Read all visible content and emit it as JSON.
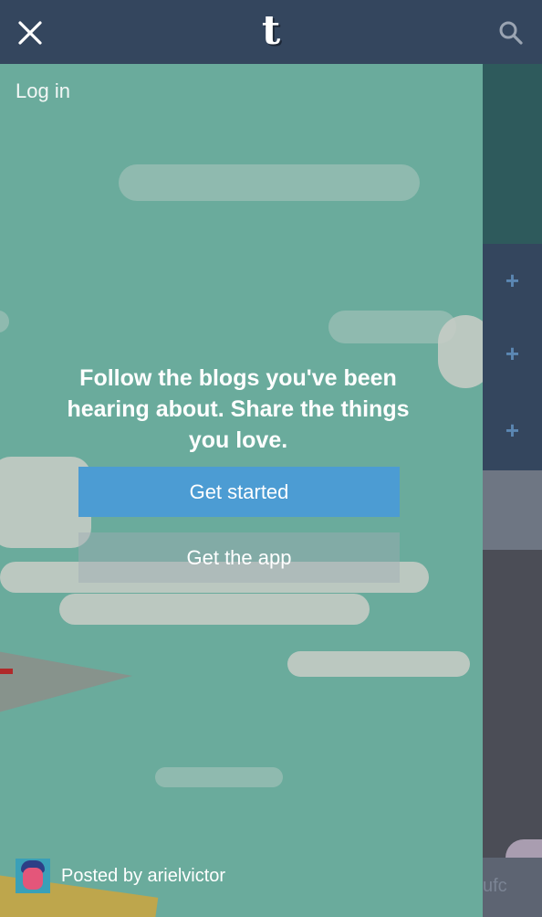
{
  "topbar": {
    "logo_letter": "t",
    "close_icon": "close-icon",
    "search_icon": "search-icon"
  },
  "drawer": {
    "login_label": "Log in",
    "headline": "Follow the blogs you've been hearing about. Share the things you love.",
    "get_started_label": "Get started",
    "get_app_label": "Get the app",
    "posted_by": "Posted by arielvictor"
  },
  "background_page": {
    "footer_fragment": "ufc",
    "follow_icon": "+"
  },
  "colors": {
    "topbar": "#34465e",
    "panel": "#6aab9c",
    "primary_button": "#4c9cd3"
  }
}
